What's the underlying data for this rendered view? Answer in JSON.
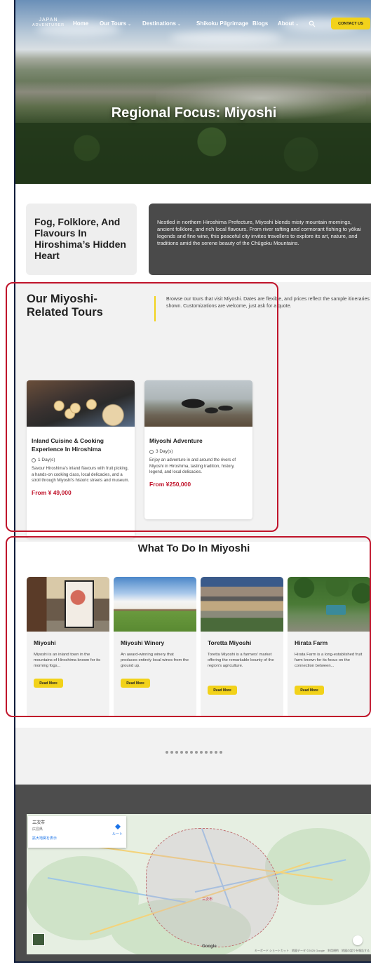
{
  "nav": {
    "logo_line1": "JAPAN",
    "logo_line2": "ADVENTURER",
    "items": [
      {
        "label": "Home",
        "has_dropdown": false
      },
      {
        "label": "Our Tours",
        "has_dropdown": true
      },
      {
        "label": "Destinations",
        "has_dropdown": true
      },
      {
        "label": "Shikoku Pilgrimage",
        "has_dropdown": false
      },
      {
        "label": "Blogs",
        "has_dropdown": false
      },
      {
        "label": "About",
        "has_dropdown": true
      }
    ],
    "chevron": "⌄",
    "contact_label": "CONTACT US",
    "search_icon": "search-icon"
  },
  "hero": {
    "title": "Regional Focus: Miyoshi"
  },
  "intro": {
    "heading": "Fog, Folklore, And Flavours In Hiroshima’s Hidden Heart",
    "body": "Nestled in northern Hiroshima Prefecture, Miyoshi blends misty mountain mornings, ancient folklore, and rich local flavours. From river rafting and cormorant fishing to yōkai legends and fine wine, this peaceful city invites travellers to explore its art, nature, and traditions amid the serene beauty of the Chūgoku Mountains."
  },
  "tours": {
    "title": "Our Miyoshi-Related Tours",
    "description": "Browse our tours that visit Miyoshi. Dates are flexible, and prices reflect the sample itineraries shown. Customizations are welcome, just ask for a quote.",
    "cards": [
      {
        "title": "Inland Cuisine & Cooking Experience In Hiroshima",
        "duration": "1 Day(s)",
        "description": "Savour Hiroshima's inland flavours with fruit picking, a hands-on cooking class, local delicacies, and a stroll through Miyoshi's historic streets and museum.",
        "price": "From ¥ 49,000"
      },
      {
        "title": "Miyoshi Adventure",
        "duration": "3 Day(s)",
        "description": "Enjoy an adventure in and around the rivers of Miyoshi in Hiroshima, tasting tradition, history, legend, and local delicacies.",
        "price": "From ¥250,000"
      }
    ]
  },
  "todo": {
    "title": "What To Do In Miyoshi",
    "read_more": "Read More",
    "cards": [
      {
        "title": "Miyoshi",
        "description": "Miyoshi is an inland town in the mountains of Hiroshima known for its morning fogs..."
      },
      {
        "title": "Miyoshi Winery",
        "description": "An award-winning winery that produces entirely local wines from the ground up."
      },
      {
        "title": "Toretta Miyoshi",
        "description": "Toretta Miyoshi is a farmers' market offering the remarkable bounty of the region's agriculture."
      },
      {
        "title": "Hirata Farm",
        "description": "Hirata Farm is a long-established fruit farm known for its focus on the connection between..."
      }
    ],
    "carousel_dot_count": 12
  },
  "map": {
    "place_name": "三次市",
    "prefecture": "広島県",
    "larger_map_link": "拡大地図を表示",
    "route_label": "ルート",
    "town_label": "三次市",
    "google_label": "Google",
    "attribution": "キーボード ショートカット　地図データ ©2025 Google　利用規約　地図の誤りを報告する"
  },
  "colors": {
    "accent_yellow": "#f2d21a",
    "price_red": "#c0142b",
    "dark_panel": "#4a4a4a",
    "annotation_red": "#c0142b"
  }
}
